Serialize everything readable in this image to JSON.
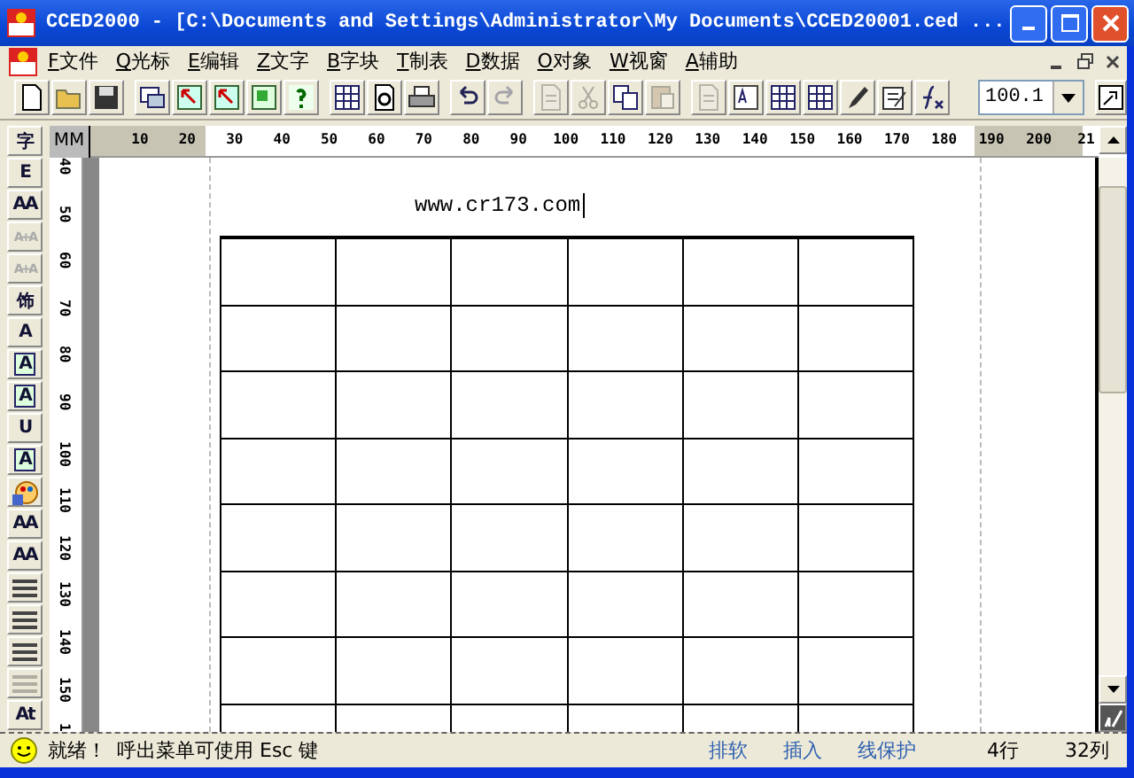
{
  "window": {
    "title": "CCED2000 - [C:\\Documents and Settings\\Administrator\\My Documents\\CCED20001.ced ..."
  },
  "menu": [
    {
      "key": "F",
      "label": "文件"
    },
    {
      "key": "Q",
      "label": "光标"
    },
    {
      "key": "E",
      "label": "编辑"
    },
    {
      "key": "Z",
      "label": "文字"
    },
    {
      "key": "B",
      "label": "字块"
    },
    {
      "key": "T",
      "label": "制表"
    },
    {
      "key": "D",
      "label": "数据"
    },
    {
      "key": "O",
      "label": "对象"
    },
    {
      "key": "W",
      "label": "视窗"
    },
    {
      "key": "A",
      "label": "辅助"
    }
  ],
  "toolbar": {
    "groups": [
      [
        {
          "disabled": false
        },
        {
          "disabled": false
        },
        {
          "disabled": false
        }
      ],
      [
        {
          "disabled": false
        },
        {
          "disabled": false
        },
        {
          "disabled": false
        },
        {
          "disabled": false
        },
        {
          "disabled": false
        }
      ],
      [
        {
          "disabled": false
        },
        {
          "disabled": false
        },
        {
          "disabled": false
        }
      ],
      [
        {
          "disabled": false
        },
        {
          "disabled": true
        }
      ],
      [
        {
          "disabled": true
        },
        {
          "disabled": true
        },
        {
          "disabled": false
        },
        {
          "disabled": true
        }
      ],
      [
        {
          "disabled": true
        },
        {
          "disabled": false
        },
        {
          "disabled": false
        },
        {
          "disabled": false
        },
        {
          "disabled": false
        },
        {
          "disabled": false
        },
        {
          "disabled": false
        }
      ]
    ],
    "zoom_value": "100.1"
  },
  "left_toolbar": [
    {
      "glyph": "字",
      "disabled": false
    },
    {
      "glyph": "E",
      "disabled": false
    },
    {
      "glyph": "AA",
      "disabled": false
    },
    {
      "glyph": "A+A",
      "disabled": true
    },
    {
      "glyph": "A+A",
      "disabled": true
    },
    {
      "glyph": "饰",
      "disabled": false
    },
    {
      "glyph": "A",
      "disabled": false
    },
    {
      "glyph": "A",
      "disabled": false
    },
    {
      "glyph": "A",
      "disabled": false
    },
    {
      "glyph": "U",
      "disabled": false
    },
    {
      "glyph": "A",
      "disabled": false
    },
    {
      "disabled": false
    },
    {
      "glyph": "AA",
      "disabled": false
    },
    {
      "glyph": "AA",
      "disabled": false
    },
    {
      "disabled": false
    },
    {
      "disabled": false
    },
    {
      "disabled": false
    },
    {
      "disabled": true
    },
    {
      "glyph": "At",
      "disabled": false
    }
  ],
  "ruler": {
    "unit": "MM",
    "horizontal": [
      "10",
      "20",
      "30",
      "40",
      "50",
      "60",
      "70",
      "80",
      "90",
      "100",
      "110",
      "120",
      "130",
      "140",
      "150",
      "160",
      "170",
      "180",
      "190",
      "200",
      "21"
    ],
    "vertical": [
      "40",
      "50",
      "60",
      "70",
      "80",
      "90",
      "100",
      "110",
      "120",
      "130",
      "140",
      "150",
      "1"
    ]
  },
  "document": {
    "text": "www.cr173.com"
  },
  "status_bar": {
    "message": "就绪！",
    "hint": "呼出菜单可使用 Esc 键",
    "indicators": [
      {
        "kind": "mode",
        "label": "排软"
      },
      {
        "kind": "mode",
        "label": "插入"
      },
      {
        "kind": "mode",
        "label": "线保护"
      },
      {
        "kind": "position",
        "label": "4行"
      },
      {
        "kind": "position",
        "label": "32列"
      }
    ]
  }
}
